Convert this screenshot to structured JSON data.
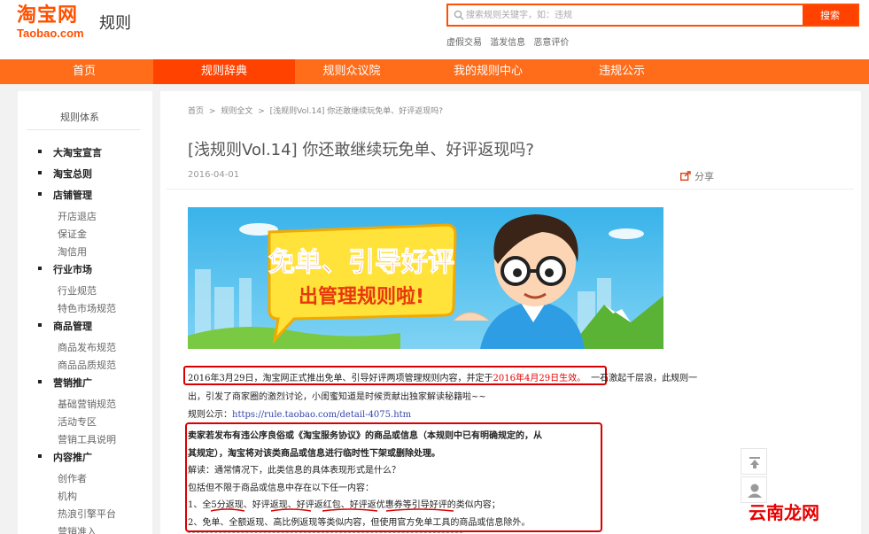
{
  "header": {
    "logo_cn": "淘宝网",
    "logo_en": "Taobao.com",
    "logo_sub": "规则",
    "search_placeholder": "搜索规则关键字，如：违规",
    "search_button": "搜索",
    "hot_links": [
      "虚假交易",
      "滥发信息",
      "恶意评价"
    ]
  },
  "nav": {
    "items": [
      "首页",
      "规则辞典",
      "规则众议院",
      "我的规则中心",
      "违规公示"
    ],
    "active_index": 1
  },
  "sidebar": {
    "title": "规则体系",
    "items": [
      {
        "label": "大淘宝宣言",
        "type": "cat"
      },
      {
        "label": "淘宝总则",
        "type": "cat"
      },
      {
        "label": "店铺管理",
        "type": "cat"
      },
      {
        "label": "开店退店",
        "type": "sub"
      },
      {
        "label": "保证金",
        "type": "sub"
      },
      {
        "label": "淘信用",
        "type": "sub"
      },
      {
        "label": "行业市场",
        "type": "cat"
      },
      {
        "label": "行业规范",
        "type": "sub"
      },
      {
        "label": "特色市场规范",
        "type": "sub"
      },
      {
        "label": "商品管理",
        "type": "cat"
      },
      {
        "label": "商品发布规范",
        "type": "sub"
      },
      {
        "label": "商品品质规范",
        "type": "sub"
      },
      {
        "label": "营销推广",
        "type": "cat"
      },
      {
        "label": "基础营销规范",
        "type": "sub"
      },
      {
        "label": "活动专区",
        "type": "sub"
      },
      {
        "label": "营销工具说明",
        "type": "sub"
      },
      {
        "label": "内容推广",
        "type": "cat"
      },
      {
        "label": "创作者",
        "type": "sub"
      },
      {
        "label": "机构",
        "type": "sub"
      },
      {
        "label": "热浪引擎平台",
        "type": "sub"
      },
      {
        "label": "营销准入",
        "type": "sub"
      }
    ]
  },
  "article": {
    "breadcrumb": [
      "首页",
      ">",
      "规则全文",
      ">",
      "[浅规则Vol.14] 你还敢继续玩免单、好评返现吗?"
    ],
    "title": "[浅规则Vol.14] 你还敢继续玩免单、好评返现吗?",
    "date": "2016-04-01",
    "share_label": "分享",
    "banner_line1": "免单、引导好评",
    "banner_line2": "出管理规则啦!",
    "p1_a": "2016年3月29日，淘宝网正式推出免单、引导好评两项管理规则内容，并定于",
    "p1_red": "2016年4月29日生效。",
    "p1_b": "一石激起千层浪，此规则一",
    "p2": "出，引发了商家圈的激烈讨论，小闺蜜知道是时候贡献出独家解读秘籍啦~~",
    "p3_label": "规则公示：",
    "p3_link": "https://rule.taobao.com/detail-4075.htm",
    "q1": "卖家若发布有违公序良俗或《淘宝服务协议》的商品或信息（本规则中已有明确规定的，从",
    "q2": "其规定），淘宝将对该类商品或信息进行临时性下架或删除处理。",
    "q3": "解读：通常情况下，此类信息的具体表现形式是什么？",
    "q4": "包括但不限于商品或信息中存在以下任一内容：",
    "q5": "1、全5分返现、好评返现、好评返红包、好评返优惠券等引导好评的类似内容；",
    "q6": "2、免单、全额返现、高比例返现等类似内容，但使用官方免单工具的商品或信息除外。"
  },
  "watermark": "云南龙网",
  "colors": {
    "brand": "#ff5000",
    "nav": "#ff6c1a",
    "nav_active": "#ff4200",
    "highlight": "#d80000"
  }
}
